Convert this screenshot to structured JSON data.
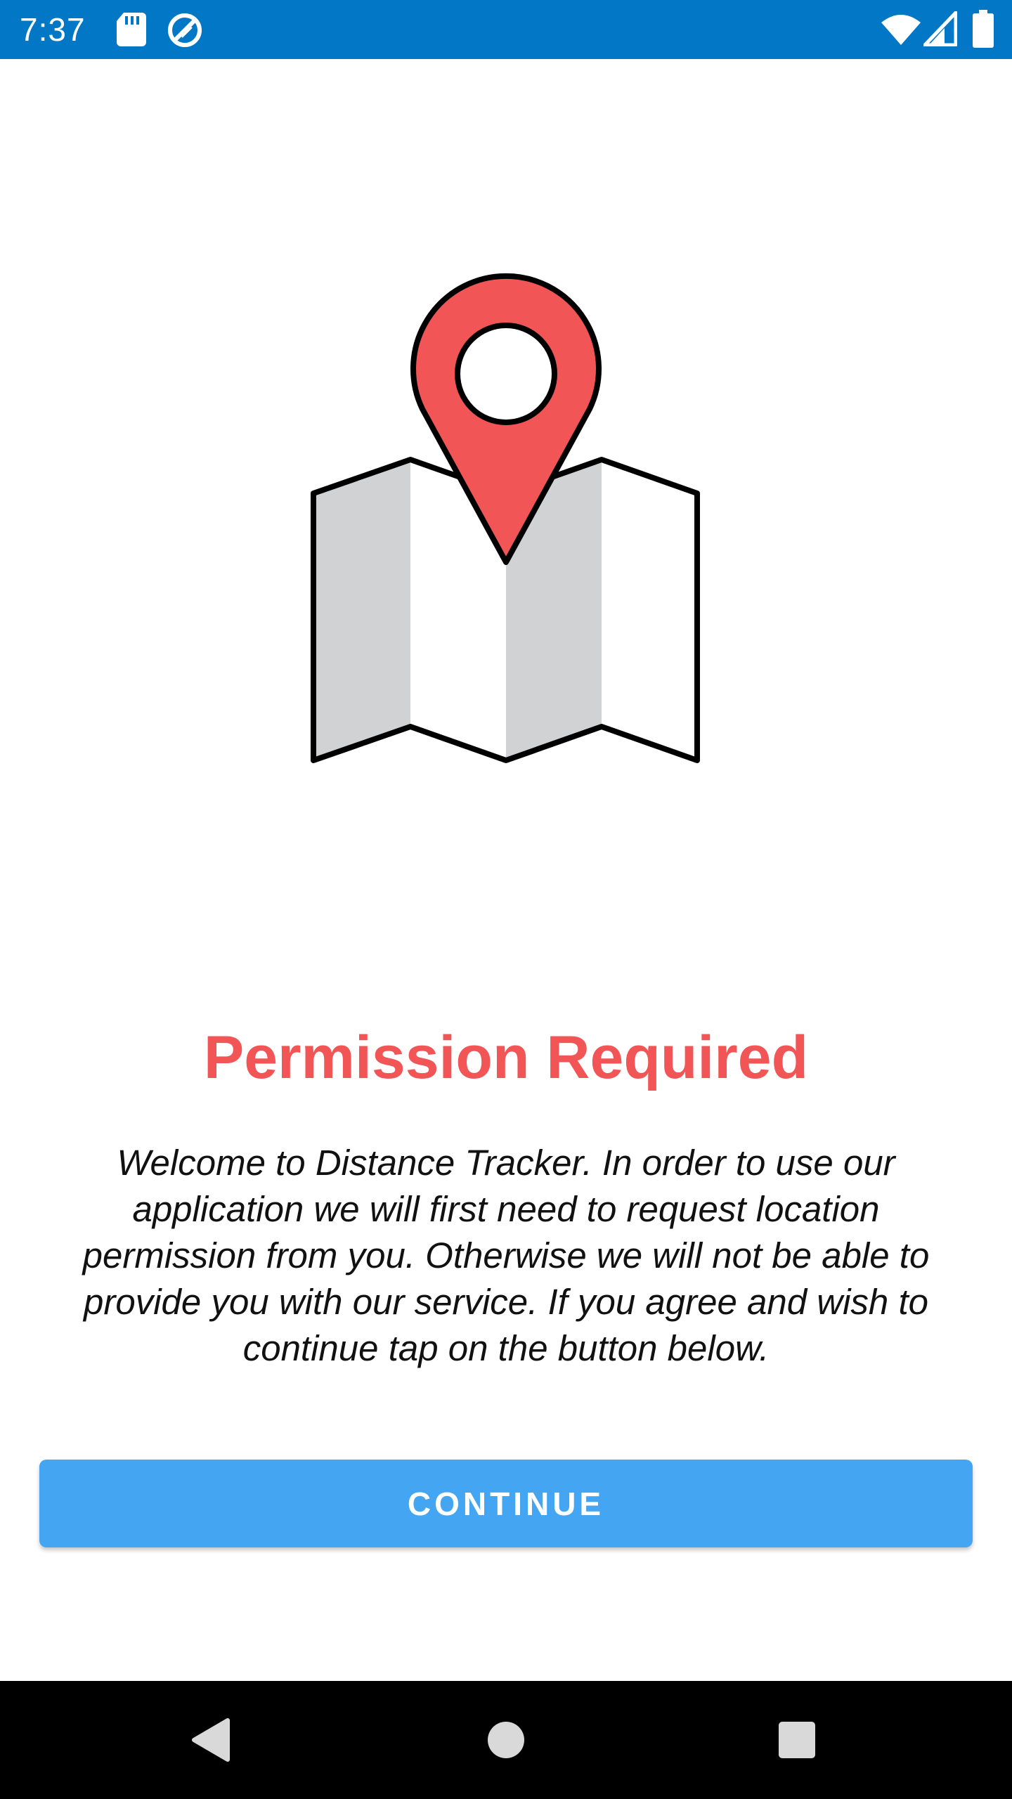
{
  "status_bar": {
    "time": "7:37",
    "background_color": "#0277c6",
    "left_icons": [
      "sd-card-icon",
      "sync-icon"
    ],
    "right_icons": [
      "wifi-icon",
      "cell-signal-icon",
      "battery-icon"
    ]
  },
  "illustration": {
    "icon": "map-pin-icon",
    "pin_color": "#f25555",
    "map_fold_color": "#d1d2d4"
  },
  "main": {
    "title": "Permission Required",
    "title_color": "#f25555",
    "body_lines": [
      "Welcome to Distance Tracker. In order to use our",
      "application we will first need to request location",
      "permission from you. Otherwise we will not be able to",
      "provide you with our service. If you agree and wish to",
      "continue tap on the button below."
    ],
    "continue_label": "CONTINUE",
    "button_color": "#44a6f3"
  },
  "nav_bar": {
    "buttons": [
      "back-icon",
      "home-icon",
      "recents-icon"
    ]
  }
}
